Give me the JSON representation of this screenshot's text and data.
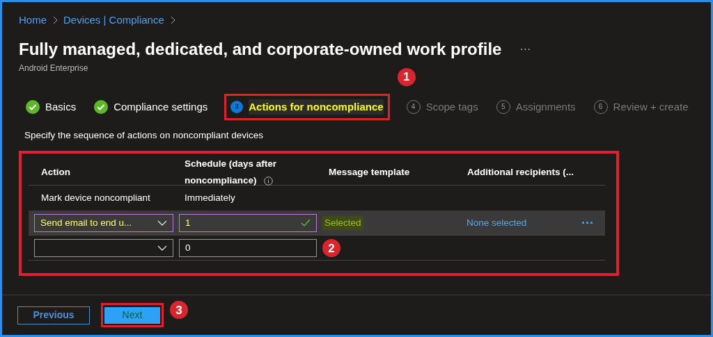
{
  "breadcrumb": [
    {
      "label": "Home"
    },
    {
      "label": "Devices | Compliance"
    }
  ],
  "title": "Fully managed, dedicated, and corporate-owned work profile",
  "more": "···",
  "subtitle": "Android Enterprise",
  "steps": [
    {
      "kind": "done",
      "label": "Basics",
      "selected": false
    },
    {
      "kind": "done",
      "label": "Compliance settings",
      "selected": false
    },
    {
      "kind": "current",
      "number": "3",
      "label": "Actions for noncompliance",
      "selected": true,
      "callout": "1"
    },
    {
      "kind": "pending",
      "number": "4",
      "label": "Scope tags",
      "selected": false
    },
    {
      "kind": "pending",
      "number": "5",
      "label": "Assignments",
      "selected": false
    },
    {
      "kind": "pending",
      "number": "6",
      "label": "Review + create",
      "selected": false
    }
  ],
  "description": "Specify the sequence of actions on noncompliant devices",
  "table": {
    "callout": "2",
    "columns": [
      {
        "label": "Action"
      },
      {
        "label": "Schedule (days after noncompliance)",
        "info": true
      },
      {
        "label": "Message template"
      },
      {
        "label": "Additional recipients (..."
      }
    ],
    "rows": [
      {
        "kind": "text",
        "action": "Mark device noncompliant",
        "schedule": "Immediately",
        "selected": false
      },
      {
        "kind": "edit",
        "action": "Send email to end u...",
        "schedule": "1",
        "valid": true,
        "template": "Selected",
        "recipients": "None selected",
        "more": "···",
        "selected": true
      },
      {
        "kind": "edit",
        "schedule": "0",
        "valid": false,
        "selected": false
      }
    ]
  },
  "footer": {
    "previous": "Previous",
    "next": "Next",
    "callout": "3"
  }
}
